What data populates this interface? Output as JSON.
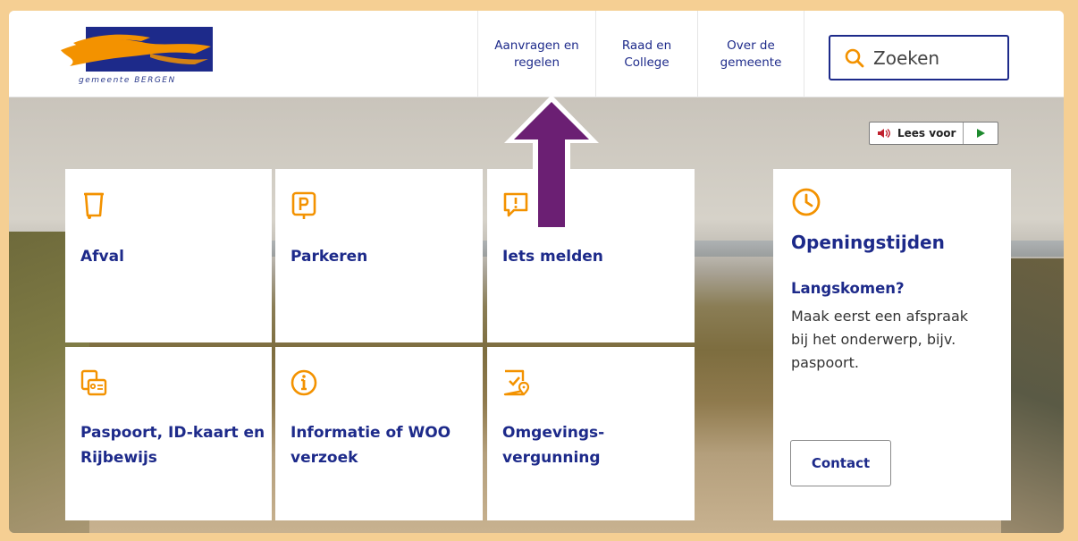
{
  "header": {
    "logo_text": "gemeente BERGEN",
    "nav": [
      {
        "label": "Aanvragen en regelen"
      },
      {
        "label": "Raad en College"
      },
      {
        "label": "Over de gemeente"
      }
    ],
    "search_placeholder": "Zoeken"
  },
  "readaloud": {
    "label": "Lees voor"
  },
  "tiles": [
    {
      "label": "Afval",
      "icon": "trash-bin-icon"
    },
    {
      "label": "Parkeren",
      "icon": "parking-icon"
    },
    {
      "label": "Iets melden",
      "icon": "report-icon"
    },
    {
      "label": "Paspoort, ID-kaart en Rijbewijs",
      "icon": "id-card-icon"
    },
    {
      "label": "Informatie of WOO verzoek",
      "icon": "info-icon"
    },
    {
      "label": "Omgevings-vergunning",
      "icon": "permit-icon"
    }
  ],
  "hours": {
    "title": "Openingstijden",
    "subtitle": "Langskomen?",
    "description": "Maak eerst een afspraak bij het onderwerp, bijv. paspoort.",
    "button": "Contact"
  },
  "colors": {
    "primary": "#1d2a8a",
    "accent": "#f39200",
    "frame": "#f5cf93",
    "arrow": "#6b1f73"
  }
}
